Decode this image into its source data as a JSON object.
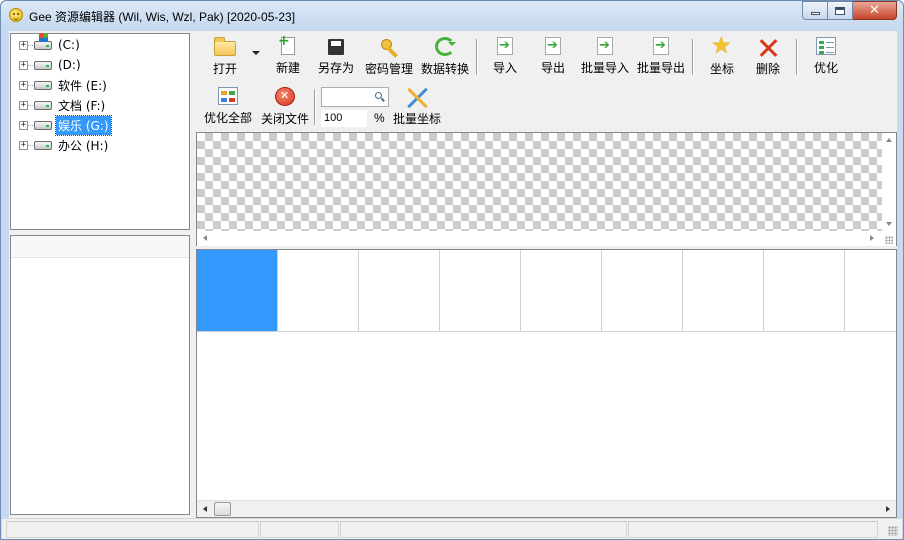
{
  "window": {
    "title": "Gee 资源编辑器 (Wil, Wis, Wzl, Pak) [2020-05-23]",
    "icon": "smiley-app-icon"
  },
  "tree": {
    "items": [
      {
        "label": "(C:)",
        "icon": "windows-drive-icon",
        "selected": false
      },
      {
        "label": "(D:)",
        "icon": "drive-icon",
        "selected": false
      },
      {
        "label": "软件 (E:)",
        "icon": "drive-icon",
        "selected": false
      },
      {
        "label": "文档 (F:)",
        "icon": "drive-icon",
        "selected": false
      },
      {
        "label": "娱乐 (G:)",
        "icon": "drive-icon",
        "selected": true
      },
      {
        "label": "办公 (H:)",
        "icon": "drive-icon",
        "selected": false
      }
    ],
    "expander_symbol": "+"
  },
  "toolbar": {
    "open": "打开",
    "new": "新建",
    "save_as": "另存为",
    "password": "密码管理",
    "convert": "数据转换",
    "import": "导入",
    "export": "导出",
    "batch_import": "批量导入",
    "batch_export": "批量导出",
    "coordinate": "坐标",
    "delete": "删除",
    "optimize": "优化",
    "optimize_all": "优化全部",
    "close_file": "关闭文件",
    "batch_coordinate": "批量坐标"
  },
  "search": {
    "value": ""
  },
  "zoom": {
    "value": "100",
    "unit": "%"
  },
  "frames": {
    "count_visible": 9,
    "selected_index": 0
  },
  "colors": {
    "selection": "#3399ff",
    "close_button": "#c7452d"
  }
}
